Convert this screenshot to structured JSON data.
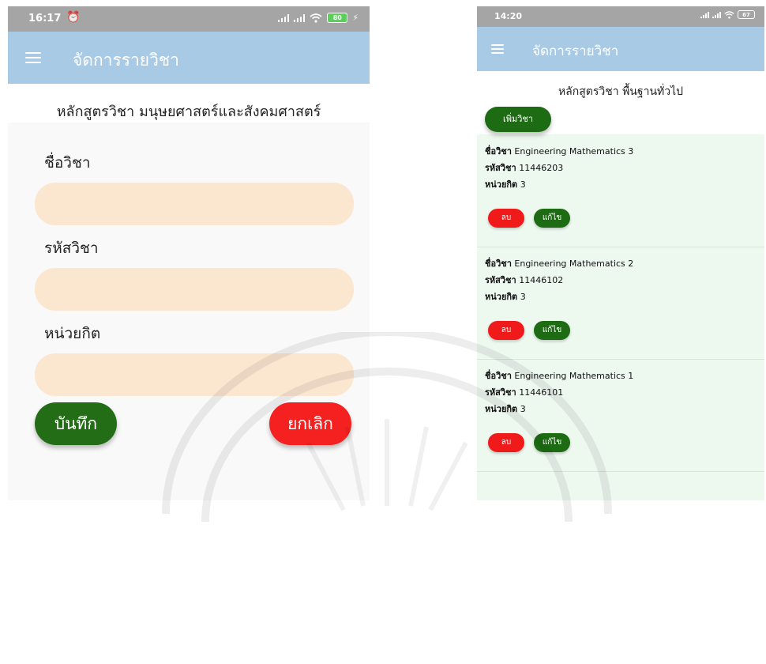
{
  "left_screen": {
    "status": {
      "time": "16:17",
      "battery": "80"
    },
    "appbar_title": "จัดการรายวิชา",
    "subtitle": "หลักสูตรวิชา มนุษยศาสตร์และสังคมศาสตร์",
    "fields": [
      {
        "label": "ชื่อวิชา",
        "value": ""
      },
      {
        "label": "รหัสวิชา",
        "value": ""
      },
      {
        "label": "หน่วยกิต",
        "value": ""
      }
    ],
    "save_label": "บันทึก",
    "cancel_label": "ยกเลิก",
    "colors": {
      "appbar": "#a8cae4",
      "input_bg": "#fbe6d0",
      "save": "#236d16",
      "cancel": "#f52020"
    }
  },
  "right_screen": {
    "status": {
      "time": "14:20",
      "battery": "67"
    },
    "appbar_title": "จัดการรายวิชา",
    "subtitle": "หลักสูตรวิชา พื้นฐานทั่วไป",
    "add_label": "เพิ่มวิชา",
    "courses": [
      {
        "name_label": "ชื่อวิชา",
        "name": "Engineering Mathematics 3",
        "code_label": "รหัสวิชา",
        "code": "11446203",
        "credit_label": "หน่วยกิต",
        "credit": "3",
        "delete_label": "ลบ",
        "edit_label": "แก้ไข"
      },
      {
        "name_label": "ชื่อวิชา",
        "name": "Engineering Mathematics 2",
        "code_label": "รหัสวิชา",
        "code": "11446102",
        "credit_label": "หน่วยกิต",
        "credit": "3",
        "delete_label": "ลบ",
        "edit_label": "แก้ไข"
      },
      {
        "name_label": "ชื่อวิชา",
        "name": "Engineering Mathematics 1",
        "code_label": "รหัสวิชา",
        "code": "11446101",
        "credit_label": "หน่วยกิต",
        "credit": "3",
        "delete_label": "ลบ",
        "edit_label": "แก้ไข"
      }
    ],
    "colors": {
      "list_bg": "#edf8ef",
      "add": "#1d6c14",
      "delete": "#f01a1a",
      "edit": "#1d6c14"
    }
  }
}
